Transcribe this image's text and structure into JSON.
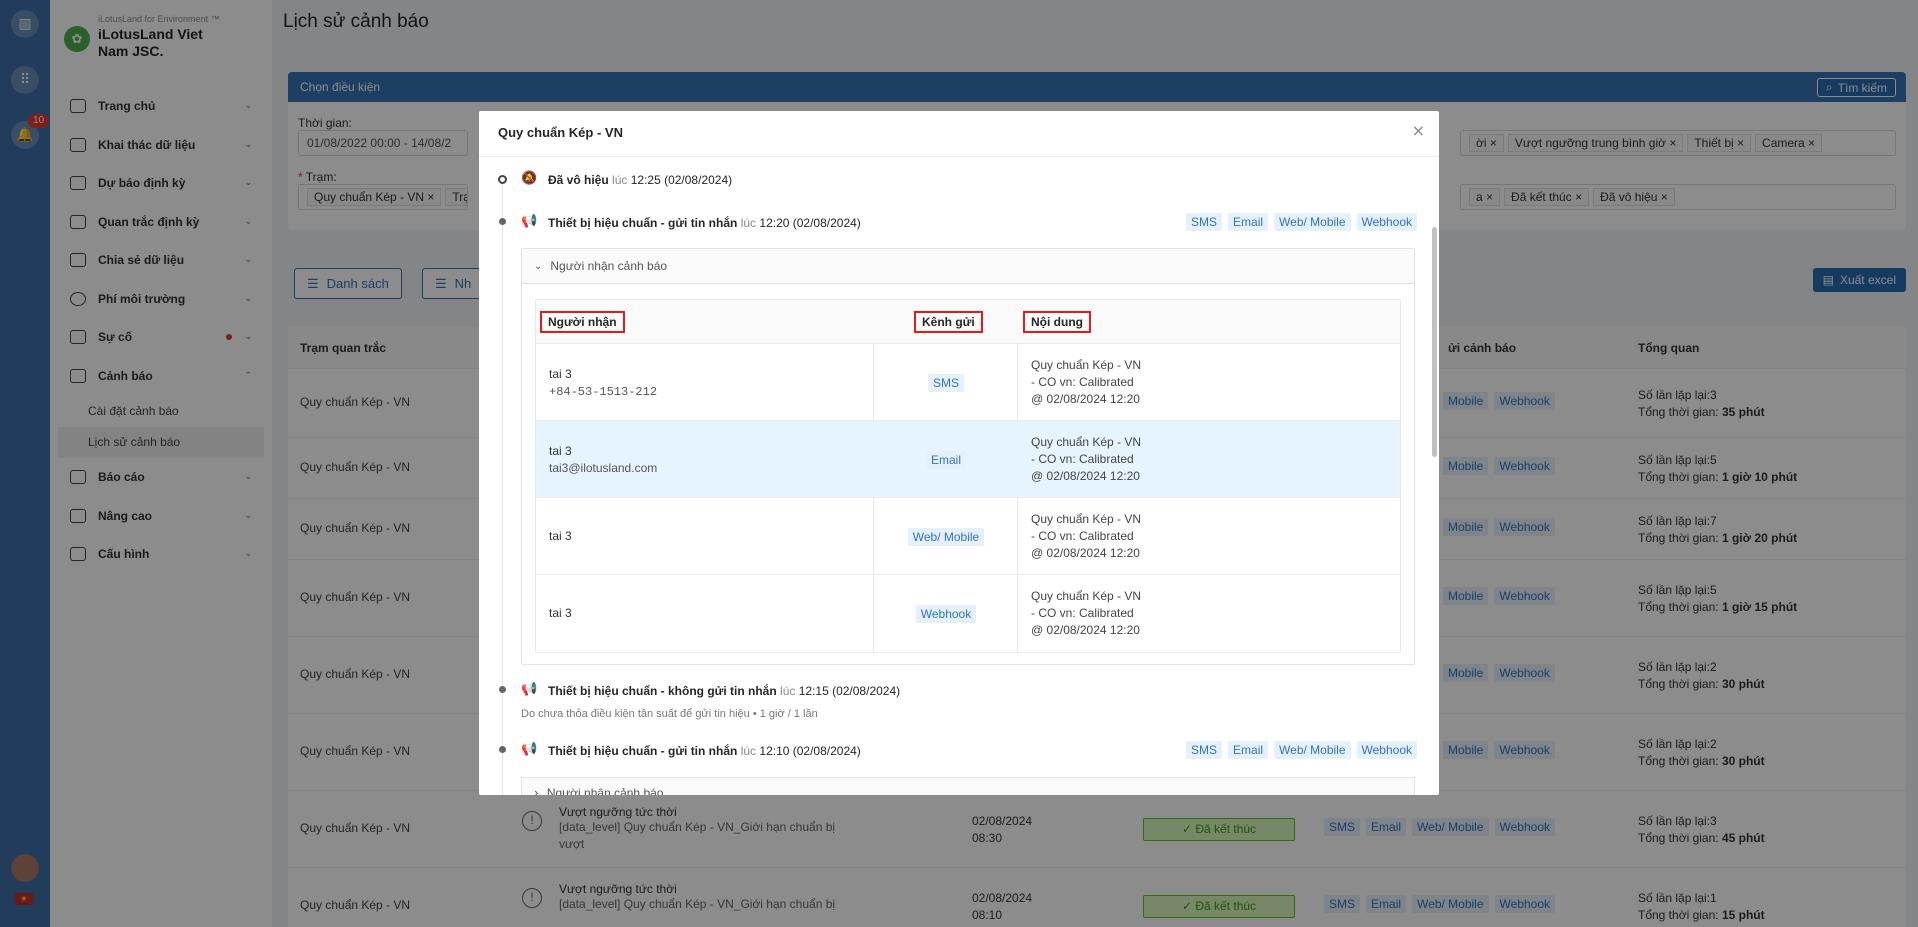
{
  "rail": {
    "badge_count": "10",
    "flag": "★"
  },
  "brand": {
    "tagline": "iLotusLand for Environment ™",
    "name": "iLotusLand Viet Nam JSC."
  },
  "sidebar": {
    "items": [
      {
        "label": "Trang chủ",
        "icon": "home-icon"
      },
      {
        "label": "Khai thác dữ liệu",
        "icon": "monitor-icon"
      },
      {
        "label": "Dự báo định kỳ",
        "icon": "chart-icon"
      },
      {
        "label": "Quan trắc định kỳ",
        "icon": "clipboard-icon"
      },
      {
        "label": "Chia sẻ dữ liệu",
        "icon": "share-icon"
      },
      {
        "label": "Phí môi trường",
        "icon": "dollar-icon"
      },
      {
        "label": "Sự cố",
        "icon": "incident-icon"
      },
      {
        "label": "Cảnh báo",
        "icon": "bell-icon"
      },
      {
        "label": "Báo cáo",
        "icon": "report-icon"
      },
      {
        "label": "Nâng cao",
        "icon": "megaphone-icon"
      },
      {
        "label": "Cấu hình",
        "icon": "settings-icon"
      }
    ],
    "submenu": [
      "Cài đặt cảnh báo",
      "Lịch sử cảnh báo"
    ]
  },
  "page": {
    "title": "Lịch sử cảnh báo",
    "filter_title": "Chọn điều kiện",
    "search_label": "Tìm kiếm",
    "time_label": "Thời gian:",
    "time_value": "01/08/2022 00:00 - 14/08/2",
    "station_label": "Trạm:",
    "required_mark": "*",
    "station_tags": [
      "Quy chuẩn Kép - VN",
      "Trạm"
    ],
    "type_tags": [
      "ời",
      "Vượt ngưỡng trung bình giờ",
      "Thiết bị",
      "Camera"
    ],
    "status_tags": [
      "a",
      "Đã kết thúc",
      "Đã vô hiệu"
    ],
    "tab_list": "Danh sách",
    "tab_group": "Nh",
    "export": "Xuất excel"
  },
  "table": {
    "headers": [
      "Trạm quan trắc",
      "ửi cảnh báo",
      "Tổng quan"
    ],
    "summary_prefix_count": "Số lần lặp lại:",
    "summary_prefix_time": "Tổng thời gian:",
    "rows": [
      {
        "station": "Quy chuẩn Kép - VN",
        "count": "3",
        "time": "35 phút"
      },
      {
        "station": "Quy chuẩn Kép - VN",
        "count": "5",
        "time": "1 giờ 10 phút"
      },
      {
        "station": "Quy chuẩn Kép - VN",
        "count": "7",
        "time": "1 giờ 20 phút"
      },
      {
        "station": "Quy chuẩn Kép - VN",
        "count": "5",
        "time": "1 giờ 15 phút"
      },
      {
        "station": "Quy chuẩn Kép - VN",
        "count": "2",
        "time": "30 phút"
      },
      {
        "station": "Quy chuẩn Kép - VN",
        "count": "2",
        "time": "30 phút"
      },
      {
        "station": "Quy chuẩn Kép - VN",
        "count": "3",
        "time": "45 phút",
        "event": "Vượt ngưỡng tức thời",
        "desc": "[data_level] Quy chuẩn Kép - VN_Giới hạn chuẩn bị vượt",
        "date": "02/08/2024",
        "hour": "08:30",
        "status": "✓ Đã kết thúc"
      },
      {
        "station": "Quy chuẩn Kép - VN",
        "count": "1",
        "time": "15 phút",
        "event": "Vượt ngưỡng tức thời",
        "desc": "[data_level] Quy chuẩn Kép - VN_Giới hạn chuẩn bị",
        "date": "02/08/2024",
        "hour": "08:10",
        "status": "✓ Đã kết thúc"
      }
    ]
  },
  "modal": {
    "title": "Quy chuẩn Kép - VN",
    "close": "×",
    "events": [
      {
        "strong": "Đã vô hiệu",
        "at": "lúc",
        "time": "12:25 (02/08/2024)"
      },
      {
        "strong": "Thiết bị hiệu chuẩn - gửi tin nhắn",
        "at": "lúc",
        "time": "12:20 (02/08/2024)"
      },
      {
        "strong": "Thiết bị hiệu chuẩn - không gửi tin nhắn",
        "at": "lúc",
        "time": "12:15 (02/08/2024)",
        "note": "Do chưa thỏa điều kiện tần suất để gửi tin hiệu • 1 giờ / 1 lần"
      },
      {
        "strong": "Thiết bị hiệu chuẩn - gửi tin nhắn",
        "at": "lúc",
        "time": "12:10 (02/08/2024)"
      }
    ],
    "channels": [
      "SMS",
      "Email",
      "Web/ Mobile",
      "Webhook"
    ],
    "receivers_title": "Người nhận cảnh báo",
    "receivers_headers": [
      "Người nhận",
      "Kênh gửi",
      "Nội dung"
    ],
    "receivers": [
      {
        "name": "tai 3",
        "contact": "+84-53-1513-212",
        "channel": "SMS",
        "l1": "Quy chuẩn Kép - VN",
        "l2": "- CO vn: Calibrated",
        "l3": "@ 02/08/2024 12:20"
      },
      {
        "name": "tai 3",
        "contact": "tai3@ilotusland.com",
        "channel": "Email",
        "l1": "Quy chuẩn Kép - VN",
        "l2": "- CO vn: Calibrated",
        "l3": "@ 02/08/2024 12:20"
      },
      {
        "name": "tai 3",
        "contact": "",
        "channel": "Web/ Mobile",
        "l1": "Quy chuẩn Kép - VN",
        "l2": "- CO vn: Calibrated",
        "l3": "@ 02/08/2024 12:20"
      },
      {
        "name": "tai 3",
        "contact": "",
        "channel": "Webhook",
        "l1": "Quy chuẩn Kép - VN",
        "l2": "- CO vn: Calibrated",
        "l3": "@ 02/08/2024 12:20"
      }
    ],
    "collapsed_title": "Người nhận cảnh báo"
  }
}
